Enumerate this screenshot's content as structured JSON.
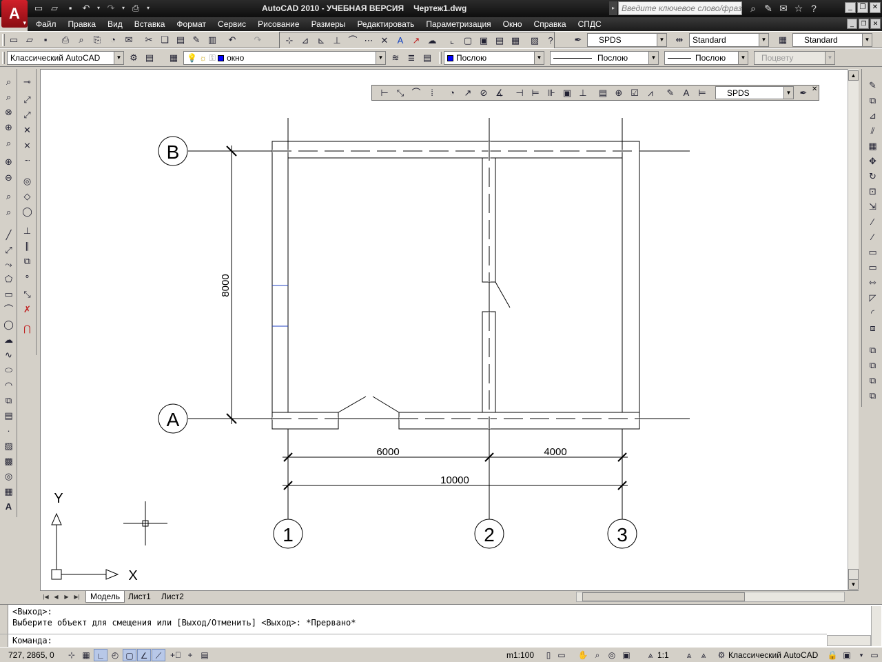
{
  "app": {
    "logo_letter": "A",
    "title": "AutoCAD 2010 - УЧЕБНАЯ ВЕРСИЯ",
    "filename": "Чертеж1.dwg",
    "search_placeholder": "Введите ключевое слово/фразу"
  },
  "menu": [
    "Файл",
    "Правка",
    "Вид",
    "Вставка",
    "Формат",
    "Сервис",
    "Рисование",
    "Размеры",
    "Редактировать",
    "Параметризация",
    "Окно",
    "Справка",
    "СПДС"
  ],
  "toolbars": {
    "text_style": "SPDS",
    "dim_style": "Standard",
    "table_style": "Standard",
    "workspace": "Классический AutoCAD",
    "layer": "окно",
    "color": "Послою",
    "linetype": "Послою",
    "lineweight": "Послою",
    "plotstyle": "Поцвету",
    "dim_toolbar_style": "SPDS"
  },
  "drawing": {
    "grid_rows": [
      "В",
      "А"
    ],
    "grid_cols": [
      "1",
      "2",
      "3"
    ],
    "dimensions": {
      "vertical": "8000",
      "span_1_2": "6000",
      "span_2_3": "4000",
      "overall": "10000"
    },
    "ucs": {
      "x": "X",
      "y": "Y"
    }
  },
  "tabs": [
    "Модель",
    "Лист1",
    "Лист2"
  ],
  "command": {
    "line1": "<Выход>:",
    "line2": "Выберите объект для смещения или [Выход/Отменить] <Выход>: *Прервано*",
    "prompt": "Команда:"
  },
  "status": {
    "coords": "727, 2865, 0",
    "scale_name": "m1:100",
    "annotation_scale": "1:1",
    "workspace": "Классический AutoCAD"
  },
  "colors": {
    "title_bg": "#1a1a1a",
    "toolbar_bg": "#d4d0c8",
    "canvas_bg": "#ffffff",
    "accent_red": "#c0141c",
    "layer_color": "#0000ff"
  }
}
